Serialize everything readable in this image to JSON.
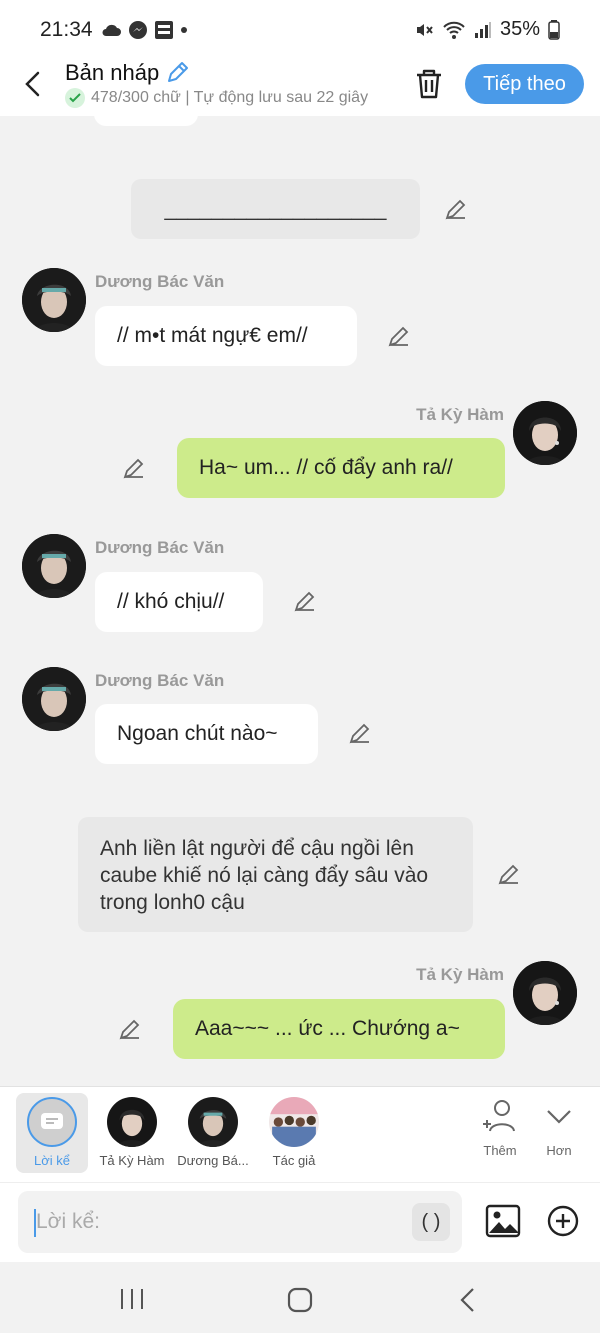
{
  "status_bar": {
    "time": "21:34",
    "battery": "35%"
  },
  "header": {
    "title": "Bản nháp",
    "subtitle": "478/300 chữ | Tự động lưu sau 22 giây",
    "next_label": "Tiếp theo"
  },
  "messages": [
    {
      "type": "narration",
      "text": "___________________"
    },
    {
      "type": "left",
      "name": "Dương Bác Văn",
      "text": "// m•t mát ngự€ em//"
    },
    {
      "type": "right",
      "name": "Tả Kỳ Hàm",
      "text": "Ha~ um... // cố đẩy anh ra//"
    },
    {
      "type": "left",
      "name": "Dương Bác Văn",
      "text": "// khó chịu//"
    },
    {
      "type": "left",
      "name": "Dương Bác Văn",
      "text": "Ngoan chút nào~"
    },
    {
      "type": "narration",
      "text": "Anh liền lật người để cậu ngồi lên caube khiế nó lại càng đẩy sâu vào trong lonh0 cậu"
    },
    {
      "type": "right",
      "name": "Tả Kỳ Hàm",
      "text": "Aaa~~~ ... ức ... Chướng a~"
    }
  ],
  "character_bar": {
    "items": [
      {
        "label": "Lời kể"
      },
      {
        "label": "Tả Kỳ Hàm"
      },
      {
        "label": "Dương Bá..."
      },
      {
        "label": "Tác giả"
      }
    ],
    "add_label": "Thêm",
    "more_label": "Hơn"
  },
  "composer": {
    "placeholder": "Lời kể:",
    "paren": "( )"
  },
  "colors": {
    "accent": "#4a9ae8",
    "right_bubble": "#cdeb8b"
  }
}
